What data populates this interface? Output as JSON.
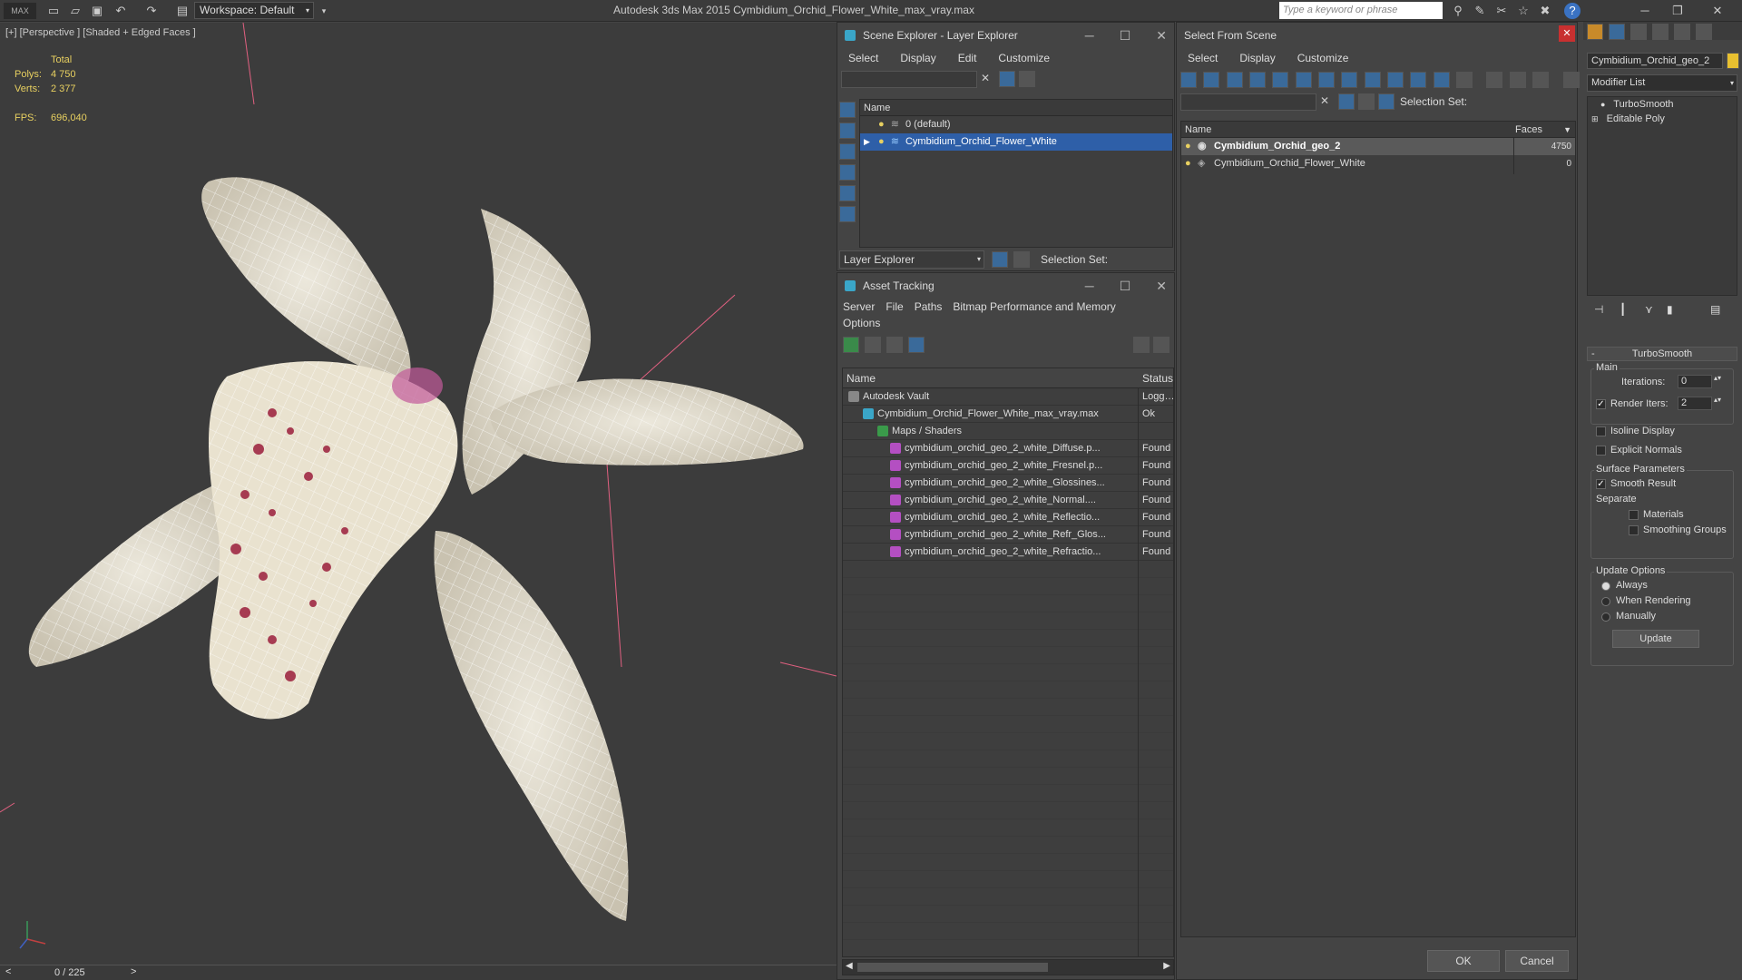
{
  "app": {
    "title": "Autodesk 3ds Max  2015    Cymbidium_Orchid_Flower_White_max_vray.max",
    "logo": "MAX",
    "workspace": "Workspace: Default",
    "search_placeholder": "Type a keyword or phrase"
  },
  "viewport": {
    "label": "[+] [Perspective ] [Shaded + Edged Faces ]",
    "stats": {
      "total_label": "Total",
      "polys_label": "Polys:",
      "polys_value": "4 750",
      "verts_label": "Verts:",
      "verts_value": "2 377",
      "fps_label": "FPS:",
      "fps_value": "696,040"
    },
    "timeline": "0 / 225"
  },
  "scene_explorer": {
    "title": "Scene Explorer - Layer Explorer",
    "menu": [
      "Select",
      "Display",
      "Edit",
      "Customize"
    ],
    "column": "Name",
    "rows": [
      {
        "label": "0 (default)",
        "selected": false
      },
      {
        "label": "Cymbidium_Orchid_Flower_White",
        "selected": true
      }
    ],
    "footer_dropdown": "Layer Explorer",
    "selection_set_label": "Selection Set:"
  },
  "asset_tracking": {
    "title": "Asset Tracking",
    "menu": [
      "Server",
      "File",
      "Paths",
      "Bitmap Performance and Memory"
    ],
    "menu2": [
      "Options"
    ],
    "columns": {
      "name": "Name",
      "status": "Status"
    },
    "rows": [
      {
        "name": "Autodesk Vault",
        "status": "Logged"
      },
      {
        "name": "Cymbidium_Orchid_Flower_White_max_vray.max",
        "status": "Ok"
      },
      {
        "name": "Maps / Shaders",
        "status": ""
      },
      {
        "name": "cymbidium_orchid_geo_2_white_Diffuse.p...",
        "status": "Found"
      },
      {
        "name": "cymbidium_orchid_geo_2_white_Fresnel.p...",
        "status": "Found"
      },
      {
        "name": "cymbidium_orchid_geo_2_white_Glossines...",
        "status": "Found"
      },
      {
        "name": "cymbidium_orchid_geo_2_white_Normal....",
        "status": "Found"
      },
      {
        "name": "cymbidium_orchid_geo_2_white_Reflectio...",
        "status": "Found"
      },
      {
        "name": "cymbidium_orchid_geo_2_white_Refr_Glos...",
        "status": "Found"
      },
      {
        "name": "cymbidium_orchid_geo_2_white_Refractio...",
        "status": "Found"
      }
    ]
  },
  "select_from_scene": {
    "title": "Select From Scene",
    "menu": [
      "Select",
      "Display",
      "Customize"
    ],
    "selection_set_label": "Selection Set:",
    "columns": {
      "name": "Name",
      "faces": "Faces"
    },
    "rows": [
      {
        "name": "Cymbidium_Orchid_geo_2",
        "faces": "4750"
      },
      {
        "name": "Cymbidium_Orchid_Flower_White",
        "faces": "0"
      }
    ],
    "ok": "OK",
    "cancel": "Cancel"
  },
  "command_panel": {
    "object_name": "Cymbidium_Orchid_geo_2",
    "modifier_list": "Modifier List",
    "stack": [
      "TurboSmooth",
      "Editable Poly"
    ],
    "rollout_title": "TurboSmooth",
    "main_label": "Main",
    "iterations_label": "Iterations:",
    "iterations_value": "0",
    "render_iters_label": "Render Iters:",
    "render_iters_value": "2",
    "isoline_label": "Isoline Display",
    "explicit_normals_label": "Explicit Normals",
    "surface_params_label": "Surface Parameters",
    "smooth_result_label": "Smooth Result",
    "separate_label": "Separate",
    "materials_label": "Materials",
    "smoothing_groups_label": "Smoothing Groups",
    "update_options_label": "Update Options",
    "always_label": "Always",
    "when_rendering_label": "When Rendering",
    "manually_label": "Manually",
    "update_button": "Update",
    "accent_color": "#2e5fa8"
  }
}
